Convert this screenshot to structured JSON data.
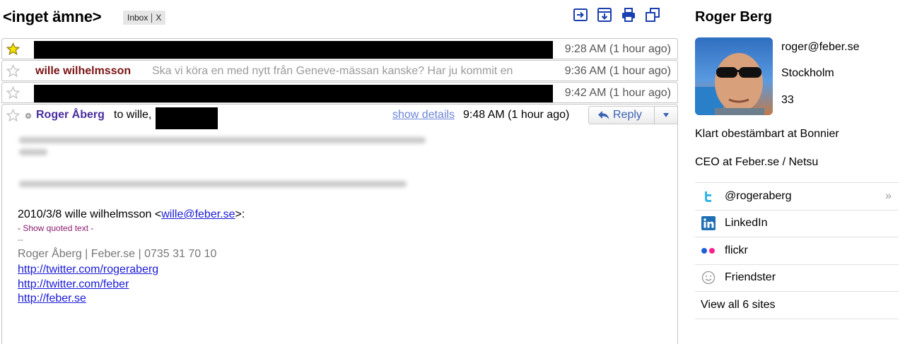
{
  "header": {
    "subject": "<inget ämne>",
    "label": "Inbox",
    "label_remove": "X"
  },
  "toolbar": {
    "icons": [
      "new-window-icon",
      "download-icon",
      "print-icon",
      "expand-icon"
    ]
  },
  "thread": {
    "rows": [
      {
        "starred": true,
        "redacted": true,
        "time": "9:28 AM (1 hour ago)"
      },
      {
        "starred": false,
        "sender": "wille wilhelmsson",
        "snippet": "Ska vi köra en med nytt från Geneve-mässan kanske? Har ju kommit en",
        "time": "9:36 AM (1 hour ago)"
      },
      {
        "starred": false,
        "redacted": true,
        "time": "9:42 AM (1 hour ago)"
      }
    ],
    "open_message": {
      "from": "Roger Åberg",
      "to_prefix": "to wille,",
      "show_details": "show details",
      "time": "9:48 AM (1 hour ago)",
      "reply": "Reply",
      "quote_intro_prefix": "2010/3/8 wille wilhelmsson <",
      "quote_email": "wille@feber.se",
      "quote_intro_suffix": ">:",
      "show_quoted": "- Show quoted text -",
      "sig_dash": "--",
      "signature": "Roger Åberg | Feber.se | 0735 31 70 10",
      "links": [
        "http://twitter.com/rogeraberg",
        "http://twitter.com/feber",
        "http://feber.se"
      ]
    }
  },
  "profile": {
    "name": "Roger Berg",
    "email": "roger@feber.se",
    "city": "Stockholm",
    "age": "33",
    "bio1": "Klart obestämbart at Bonnier",
    "bio2": "CEO at Feber.se / Netsu",
    "sites": [
      {
        "label": "@rogeraberg",
        "icon": "twitter-icon"
      },
      {
        "label": "LinkedIn",
        "icon": "linkedin-icon"
      },
      {
        "label": "flickr",
        "icon": "flickr-icon"
      },
      {
        "label": "Friendster",
        "icon": "friendster-icon"
      }
    ],
    "view_all": "View all 6 sites"
  },
  "colors": {
    "sender": "#7a1414",
    "from": "#4a2ea0",
    "link": "#1a1ad8",
    "reply": "#3a62b5",
    "toolbar_icon": "#1a3fb0"
  }
}
